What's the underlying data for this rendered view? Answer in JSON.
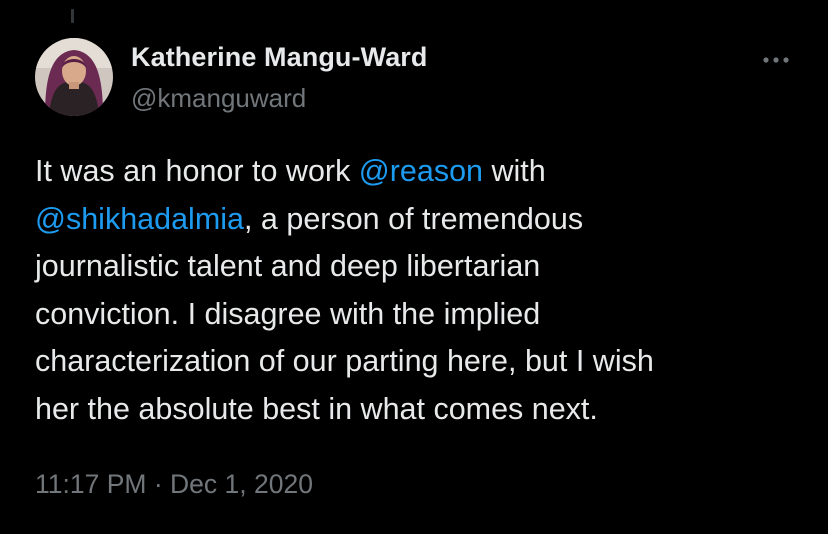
{
  "author": {
    "name": "Katherine Mangu-Ward",
    "handle": "@kmanguward",
    "avatar_icon": "profile-photo"
  },
  "more_icon": "more-horizontal-icon",
  "tweet": {
    "lines": [
      [
        {
          "text": "It was an honor to work ",
          "mention": false
        },
        {
          "text": "@reason",
          "mention": true
        },
        {
          "text": " with",
          "mention": false
        }
      ],
      [
        {
          "text": "@shikhadalmia",
          "mention": true
        },
        {
          "text": ", a person of tremendous",
          "mention": false
        }
      ],
      [
        {
          "text": "journalistic talent and deep libertarian",
          "mention": false
        }
      ],
      [
        {
          "text": "conviction. I disagree with the implied",
          "mention": false
        }
      ],
      [
        {
          "text": "characterization of our parting here, but I wish",
          "mention": false
        }
      ],
      [
        {
          "text": "her the absolute best in what comes next.",
          "mention": false
        }
      ]
    ]
  },
  "meta": {
    "time": "11:17 PM",
    "separator": " · ",
    "date": "Dec 1, 2020"
  },
  "colors": {
    "background": "#000000",
    "text": "#e7e9ea",
    "secondary": "#71767b",
    "link": "#1d9bf0"
  }
}
